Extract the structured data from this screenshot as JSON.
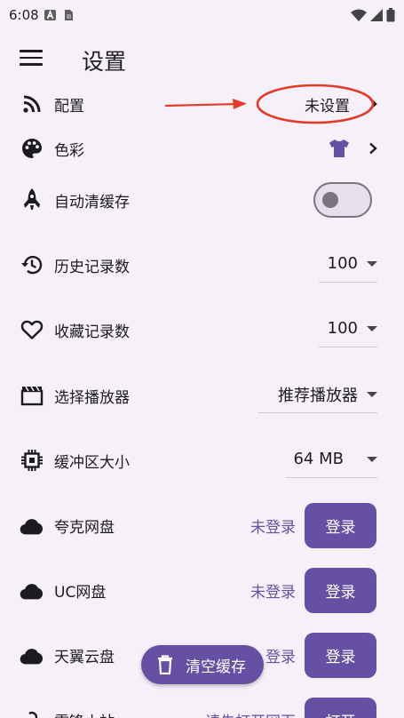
{
  "status_bar": {
    "time": "6:08"
  },
  "header": {
    "title": "设置"
  },
  "rows": {
    "config": {
      "label": "配置",
      "value": "未设置"
    },
    "color": {
      "label": "色彩"
    },
    "auto_clear": {
      "label": "自动清缓存",
      "toggle_on": false
    },
    "history": {
      "label": "历史记录数",
      "value": "100"
    },
    "favorites": {
      "label": "收藏记录数",
      "value": "100"
    },
    "player": {
      "label": "选择播放器",
      "value": "推荐播放器"
    },
    "buffer": {
      "label": "缓冲区大小",
      "value": "64 MB"
    },
    "quark": {
      "label": "夸克网盘",
      "status": "未登录",
      "button": "登录"
    },
    "uc": {
      "label": "UC网盘",
      "status": "未登录",
      "button": "登录"
    },
    "tianyi": {
      "label": "天翼云盘",
      "status": "登录",
      "button": "登录"
    },
    "partial": {
      "label": "雷锋小站",
      "status": "请先打开网页",
      "button": "打开"
    }
  },
  "fab": {
    "label": "清空缓存"
  },
  "colors": {
    "accent": "#6650a4",
    "background": "#f6f1f9",
    "annotation": "#e23b2a"
  }
}
